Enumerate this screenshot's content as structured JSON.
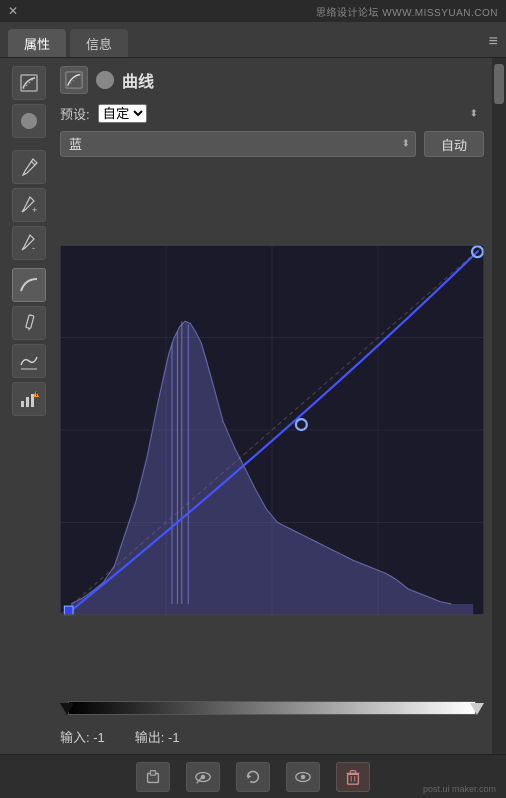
{
  "topbar": {
    "close_label": "✕",
    "watermark": "思络设计论坛 WWW.MISSYUAN.CON"
  },
  "tabs": {
    "items": [
      {
        "label": "属性",
        "active": true
      },
      {
        "label": "信息",
        "active": false
      }
    ],
    "menu_icon": "≡"
  },
  "panel": {
    "title": "曲线",
    "preset_label": "预设:",
    "preset_value": "自定",
    "channel_label": "蓝",
    "auto_btn_label": "自动",
    "input_label": "输入: -1",
    "output_label": "输出: -1"
  },
  "tools": [
    {
      "name": "pointer-tool",
      "icon": "✦"
    },
    {
      "name": "eyedropper-tool",
      "icon": "✒"
    },
    {
      "name": "eyedropper-plus-tool",
      "icon": "✒"
    },
    {
      "name": "eyedropper-minus-tool",
      "icon": "✒"
    },
    {
      "name": "curve-tool",
      "icon": "∿"
    },
    {
      "name": "pencil-tool",
      "icon": "✏"
    },
    {
      "name": "smooth-tool",
      "icon": "∿"
    },
    {
      "name": "histogram-tool",
      "icon": "▦"
    }
  ],
  "bottom_toolbar": {
    "buttons": [
      {
        "name": "clip-btn",
        "icon": "⬛"
      },
      {
        "name": "eye-btn",
        "icon": "👁"
      },
      {
        "name": "reset-btn",
        "icon": "↩"
      },
      {
        "name": "visibility-btn",
        "icon": "👁"
      },
      {
        "name": "delete-btn",
        "icon": "🗑"
      }
    ],
    "credit": "post.ui maker.com"
  },
  "colors": {
    "bg": "#3c3c3c",
    "panel_bg": "#3c3c3c",
    "input_bg": "#555",
    "curve_bg": "#1a1a2e",
    "curve_fill": "rgba(120,120,200,0.35)",
    "curve_line": "#4466ff",
    "accent_blue": "#5577ff"
  }
}
